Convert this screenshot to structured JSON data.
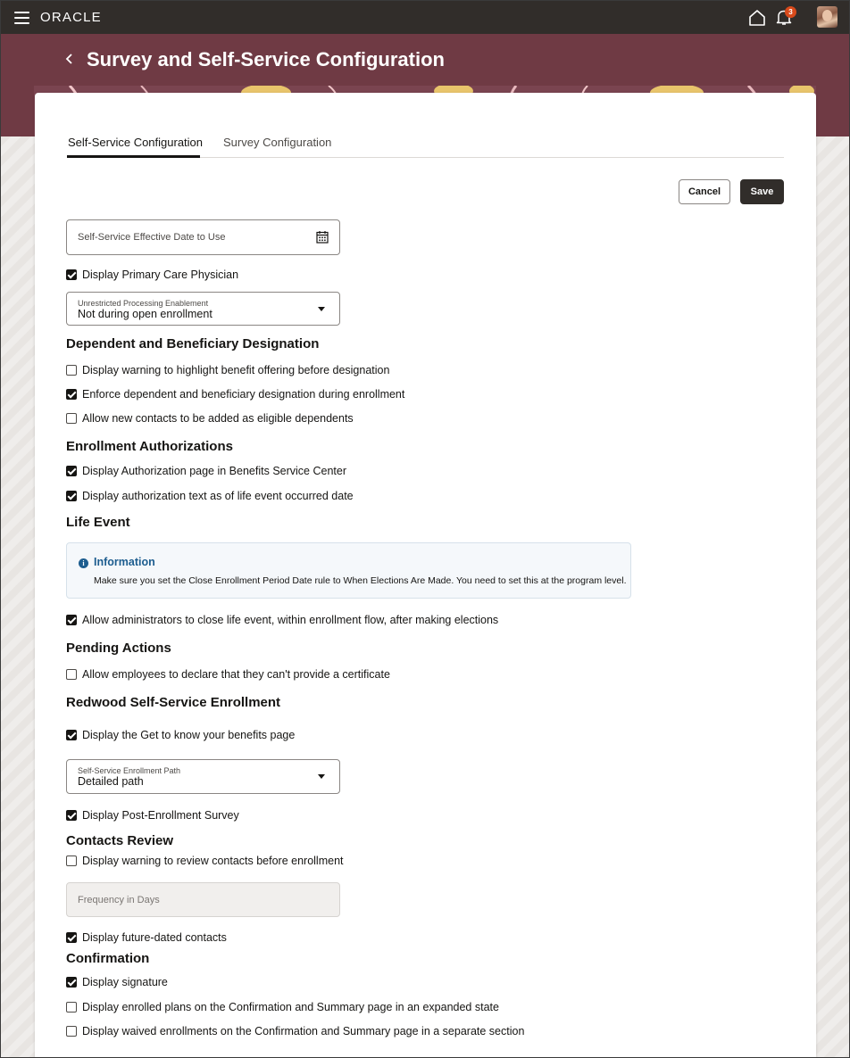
{
  "header": {
    "logo": "ORACLE",
    "notification_count": "3",
    "icons": [
      "hamburger-menu-icon",
      "home-icon",
      "bell-icon",
      "avatar"
    ]
  },
  "page": {
    "title": "Survey and Self-Service Configuration"
  },
  "tabs": [
    {
      "label": "Self-Service Configuration",
      "active": true
    },
    {
      "label": "Survey Configuration",
      "active": false
    }
  ],
  "actions": {
    "cancel": "Cancel",
    "save": "Save"
  },
  "fields": {
    "effective_date": {
      "placeholder": "Self-Service Effective Date to Use"
    },
    "unrestricted": {
      "label": "Unrestricted Processing Enablement",
      "value": "Not during open enrollment"
    },
    "enrollment_path": {
      "label": "Self-Service Enrollment Path",
      "value": "Detailed path"
    },
    "frequency": {
      "placeholder": "Frequency in Days"
    }
  },
  "checks": {
    "primary_care": {
      "label": "Display Primary Care Physician",
      "checked": true
    },
    "warning_offering": {
      "label": "Display warning to highlight benefit offering before designation",
      "checked": false
    },
    "enforce_designation": {
      "label": "Enforce dependent and beneficiary designation during enrollment",
      "checked": true
    },
    "allow_new_contacts": {
      "label": "Allow new contacts to be added as eligible dependents",
      "checked": false
    },
    "auth_page": {
      "label": "Display Authorization page in Benefits Service Center",
      "checked": true
    },
    "auth_text": {
      "label": "Display authorization text as of life event occurred date",
      "checked": true
    },
    "close_life_event": {
      "label": "Allow administrators to close life event, within enrollment flow, after making elections",
      "checked": true
    },
    "declare_certificate": {
      "label": "Allow employees to declare that they can't provide a certificate",
      "checked": false
    },
    "get_to_know": {
      "label": "Display the Get to know your benefits page",
      "checked": true
    },
    "post_survey": {
      "label": "Display Post-Enrollment Survey",
      "checked": true
    },
    "review_contacts": {
      "label": "Display warning to review contacts before enrollment",
      "checked": false
    },
    "future_contacts": {
      "label": "Display future-dated contacts",
      "checked": true
    },
    "signature": {
      "label": "Display signature",
      "checked": true
    },
    "expanded_plans": {
      "label": "Display enrolled plans on the Confirmation and Summary page in an expanded state",
      "checked": false
    },
    "waived_section": {
      "label": "Display waived enrollments on the Confirmation and Summary page in a separate section",
      "checked": false
    }
  },
  "sections": {
    "dependent": "Dependent and Beneficiary Designation",
    "authorizations": "Enrollment Authorizations",
    "life_event": "Life Event",
    "pending": "Pending Actions",
    "redwood": "Redwood Self-Service Enrollment",
    "contacts": "Contacts Review",
    "confirmation": "Confirmation"
  },
  "info": {
    "title": "Information",
    "text": "Make sure you set the Close Enrollment Period Date rule to When Elections Are Made. You need to set this at the program level."
  },
  "colors": {
    "topbar": "#312d2a",
    "banner": "#6f3a44",
    "info_accent": "#1d5d8f",
    "badge": "#d84a1b"
  }
}
